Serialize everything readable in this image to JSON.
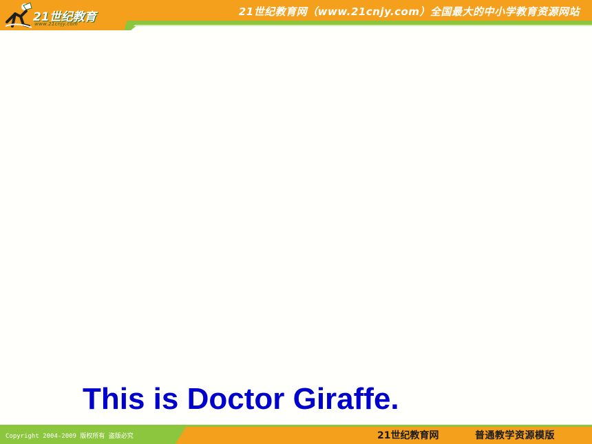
{
  "header": {
    "logo_brand": "21世纪教育",
    "logo_url": "www.21cnjy.com",
    "slogan": "21世纪教育网（www.21cnjy.com）全国最大的中小学教育资源网站"
  },
  "slide": {
    "sentence": "This is Doctor Giraffe."
  },
  "footer": {
    "copyright": "Copyright 2004-2009 版权所有 盗版必究",
    "brand": "21世纪教育网",
    "template": "普通教学资源模版"
  },
  "colors": {
    "header_orange": "#f5a01c",
    "header_green": "#8cc63f",
    "footer_orange": "#f5a01c",
    "footer_green": "#8cc63f",
    "text_blue": "#0000cc",
    "background": "#fffffb"
  },
  "icons": {
    "logo": "running-figure-logo-icon"
  }
}
